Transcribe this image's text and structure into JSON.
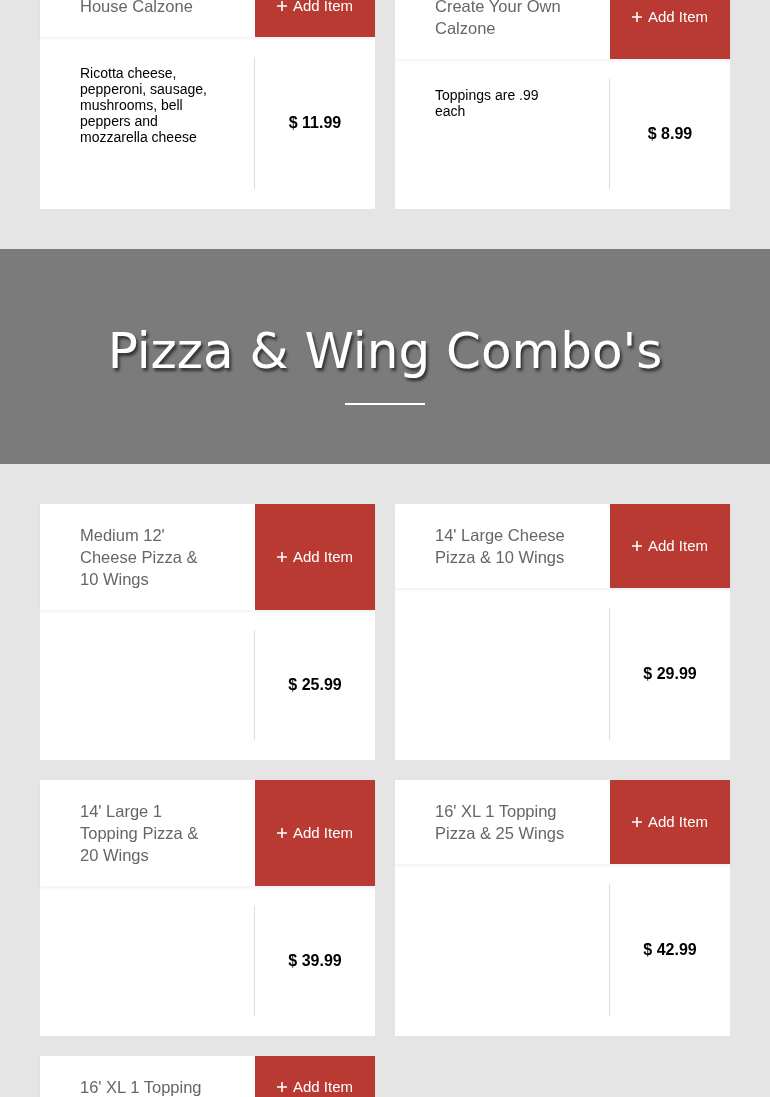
{
  "calzones": [
    {
      "title": "House Calzone",
      "button": "Add Item",
      "description": "Ricotta cheese, pepperoni, sausage, mushrooms, bell peppers and mozzarella cheese",
      "price": "$ 11.99"
    },
    {
      "title": "Create Your Own Calzone",
      "button": "Add Item",
      "description": "Toppings are .99 each",
      "price": "$ 8.99"
    }
  ],
  "section": {
    "title": "Pizza & Wing Combo's"
  },
  "combos": [
    {
      "title": "Medium 12' Cheese Pizza & 10 Wings",
      "button": "Add Item",
      "price": "$ 25.99"
    },
    {
      "title": "14' Large Cheese Pizza & 10 Wings",
      "button": "Add Item",
      "price": "$ 29.99"
    },
    {
      "title": "14' Large 1 Topping Pizza & 20 Wings",
      "button": "Add Item",
      "price": "$ 39.99"
    },
    {
      "title": "16' XL 1 Topping Pizza & 25 Wings",
      "button": "Add Item",
      "price": "$ 42.99"
    },
    {
      "title": "16' XL 1 Topping",
      "button": "Add Item"
    }
  ]
}
